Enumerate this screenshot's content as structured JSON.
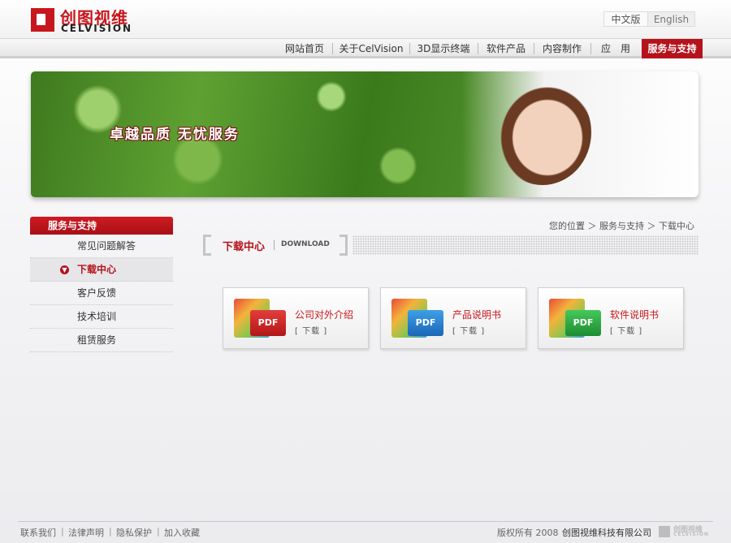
{
  "header": {
    "logo_cn": "创图视维",
    "logo_en": "CELVISION",
    "lang_cn": "中文版",
    "lang_en": "English"
  },
  "nav": {
    "items": [
      {
        "label": "网站首页"
      },
      {
        "label": "关于CelVision"
      },
      {
        "label": "3D显示终端"
      },
      {
        "label": "软件产品"
      },
      {
        "label": "内容制作"
      },
      {
        "label": "应　用"
      },
      {
        "label": "服务与支持",
        "active": true
      }
    ]
  },
  "banner": {
    "slogan": "卓越品质 无忧服务"
  },
  "sidebar": {
    "title": "服务与支持",
    "items": [
      {
        "label": "常见问题解答"
      },
      {
        "label": "下载中心",
        "active": true
      },
      {
        "label": "客户反馈"
      },
      {
        "label": "技术培训"
      },
      {
        "label": "租赁服务"
      }
    ]
  },
  "breadcrumb": {
    "text": "您的位置 ＞ 服务与支持 ＞ 下载中心"
  },
  "section": {
    "title_cn": "下载中心",
    "title_en": "DOWNLOAD"
  },
  "downloads": [
    {
      "name": "公司对外介绍",
      "action": "[ 下载 ]",
      "icon_label": "PDF",
      "color": "#c8161d"
    },
    {
      "name": "产品说明书",
      "action": "[ 下载 ]",
      "icon_label": "PDF",
      "color": "#1b66b8"
    },
    {
      "name": "软件说明书",
      "action": "[ 下载 ]",
      "icon_label": "PDF",
      "color": "#1e8c32"
    }
  ],
  "footer": {
    "links": [
      {
        "label": "联系我们"
      },
      {
        "label": "法律声明"
      },
      {
        "label": "隐私保护"
      },
      {
        "label": "加入收藏"
      }
    ],
    "separator": "|",
    "copyright": "版权所有 2008",
    "company": "创图视维科技有限公司",
    "logo_cn": "创图视维",
    "logo_en": "CELVISION"
  }
}
